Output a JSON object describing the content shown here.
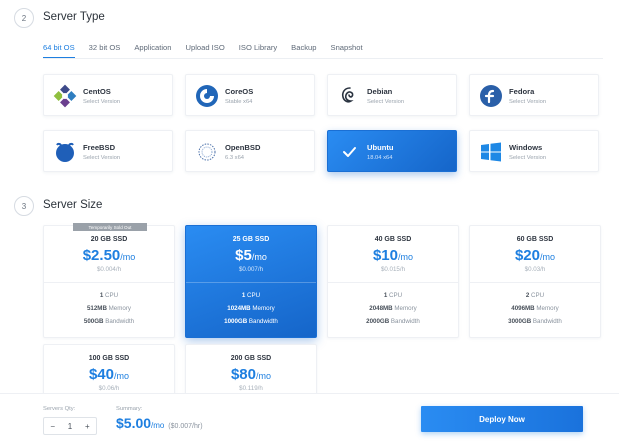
{
  "server_type": {
    "step": "2",
    "title": "Server Type",
    "tabs": [
      "64 bit OS",
      "32 bit OS",
      "Application",
      "Upload ISO",
      "ISO Library",
      "Backup",
      "Snapshot"
    ],
    "os": [
      {
        "name": "CentOS",
        "sub": "Select Version",
        "icon": "centos-icon"
      },
      {
        "name": "CoreOS",
        "sub": "Stable  x64",
        "icon": "coreos-icon"
      },
      {
        "name": "Debian",
        "sub": "Select Version",
        "icon": "debian-icon"
      },
      {
        "name": "Fedora",
        "sub": "Select Version",
        "icon": "fedora-icon"
      },
      {
        "name": "FreeBSD",
        "sub": "Select Version",
        "icon": "freebsd-icon"
      },
      {
        "name": "OpenBSD",
        "sub": "6.3  x64",
        "icon": "openbsd-icon"
      },
      {
        "name": "Ubuntu",
        "sub": "18.04  x64",
        "icon": "check-icon"
      },
      {
        "name": "Windows",
        "sub": "Select Version",
        "icon": "windows-icon"
      }
    ]
  },
  "server_size": {
    "step": "3",
    "title": "Server Size",
    "sold_out_badge": "Temporarily Sold Out",
    "plans": [
      {
        "ssd": "20 GB SSD",
        "price": "$2.50",
        "per": "/mo",
        "hourly": "$0.004/h",
        "cpu_n": "1",
        "cpu": " CPU",
        "mem_n": "512MB",
        "mem": " Memory",
        "bw_n": "500GB",
        "bw": " Bandwidth"
      },
      {
        "ssd": "25 GB SSD",
        "price": "$5",
        "per": "/mo",
        "hourly": "$0.007/h",
        "cpu_n": "1",
        "cpu": " CPU",
        "mem_n": "1024MB",
        "mem": " Memory",
        "bw_n": "1000GB",
        "bw": " Bandwidth"
      },
      {
        "ssd": "40 GB SSD",
        "price": "$10",
        "per": "/mo",
        "hourly": "$0.015/h",
        "cpu_n": "1",
        "cpu": " CPU",
        "mem_n": "2048MB",
        "mem": " Memory",
        "bw_n": "2000GB",
        "bw": " Bandwidth"
      },
      {
        "ssd": "60 GB SSD",
        "price": "$20",
        "per": "/mo",
        "hourly": "$0.03/h",
        "cpu_n": "2",
        "cpu": " CPU",
        "mem_n": "4096MB",
        "mem": " Memory",
        "bw_n": "3000GB",
        "bw": " Bandwidth"
      },
      {
        "ssd": "100 GB SSD",
        "price": "$40",
        "per": "/mo",
        "hourly": "$0.06/h"
      },
      {
        "ssd": "200 GB SSD",
        "price": "$80",
        "per": "/mo",
        "hourly": "$0.119/h"
      }
    ]
  },
  "footer": {
    "qty_label": "Servers Qty:",
    "qty_minus": "−",
    "qty_value": "1",
    "qty_plus": "+",
    "summary_label": "Summary:",
    "summary_price": "$5.00",
    "summary_per": "/mo",
    "summary_hourly": "($0.007/hr)",
    "deploy_label": "Deploy Now"
  },
  "colors": {
    "accent": "#1e7fe0",
    "selected_dark": "#1565c9"
  }
}
